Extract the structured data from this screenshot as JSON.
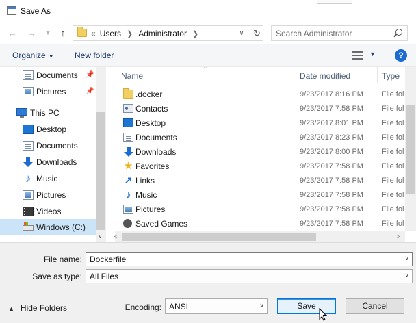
{
  "window": {
    "title": "Save As"
  },
  "address": {
    "lead": "«",
    "crumbs": [
      "Users",
      "Administrator"
    ],
    "search_placeholder": "Search Administrator"
  },
  "toolbar": {
    "organize": "Organize",
    "new_folder": "New folder",
    "help": "?"
  },
  "nav": {
    "items": [
      {
        "label": "Documents",
        "icon": "documents-icon",
        "pinned": true
      },
      {
        "label": "Pictures",
        "icon": "pictures-icon",
        "pinned": true
      },
      {
        "label": "This PC",
        "icon": "computer-icon"
      },
      {
        "label": "Desktop",
        "icon": "desktop-icon"
      },
      {
        "label": "Documents",
        "icon": "documents-icon"
      },
      {
        "label": "Downloads",
        "icon": "downloads-icon"
      },
      {
        "label": "Music",
        "icon": "music-icon"
      },
      {
        "label": "Pictures",
        "icon": "pictures-icon"
      },
      {
        "label": "Videos",
        "icon": "videos-icon"
      },
      {
        "label": "Windows (C:)",
        "icon": "drive-icon",
        "selected": true
      }
    ]
  },
  "columns": {
    "name": "Name",
    "date": "Date modified",
    "type": "Type"
  },
  "files": [
    {
      "name": ".docker",
      "date": "9/23/2017 8:16 PM",
      "type": "File fol",
      "icon": "folder-icon"
    },
    {
      "name": "Contacts",
      "date": "9/23/2017 7:58 PM",
      "type": "File fol",
      "icon": "contacts-icon"
    },
    {
      "name": "Desktop",
      "date": "9/23/2017 8:01 PM",
      "type": "File fol",
      "icon": "desktop-icon"
    },
    {
      "name": "Documents",
      "date": "9/23/2017 8:23 PM",
      "type": "File fol",
      "icon": "documents-icon"
    },
    {
      "name": "Downloads",
      "date": "9/23/2017 8:00 PM",
      "type": "File fol",
      "icon": "downloads-icon"
    },
    {
      "name": "Favorites",
      "date": "9/23/2017 7:58 PM",
      "type": "File fol",
      "icon": "favorites-icon"
    },
    {
      "name": "Links",
      "date": "9/23/2017 7:58 PM",
      "type": "File fol",
      "icon": "links-icon"
    },
    {
      "name": "Music",
      "date": "9/23/2017 7:58 PM",
      "type": "File fol",
      "icon": "music-icon"
    },
    {
      "name": "Pictures",
      "date": "9/23/2017 7:58 PM",
      "type": "File fol",
      "icon": "pictures-icon"
    },
    {
      "name": "Saved Games",
      "date": "9/23/2017 7:58 PM",
      "type": "File fol",
      "icon": "saved-games-icon"
    }
  ],
  "form": {
    "file_name_label": "File name:",
    "file_name_value": "Dockerfile",
    "save_type_label": "Save as type:",
    "save_type_value": "All Files",
    "encoding_label": "Encoding:",
    "encoding_value": "ANSI"
  },
  "footer": {
    "hide_folders": "Hide Folders",
    "save": "Save",
    "cancel": "Cancel"
  },
  "colors": {
    "accent": "#0078d7",
    "selection": "#cce4f7",
    "link": "#1e3a6e"
  }
}
